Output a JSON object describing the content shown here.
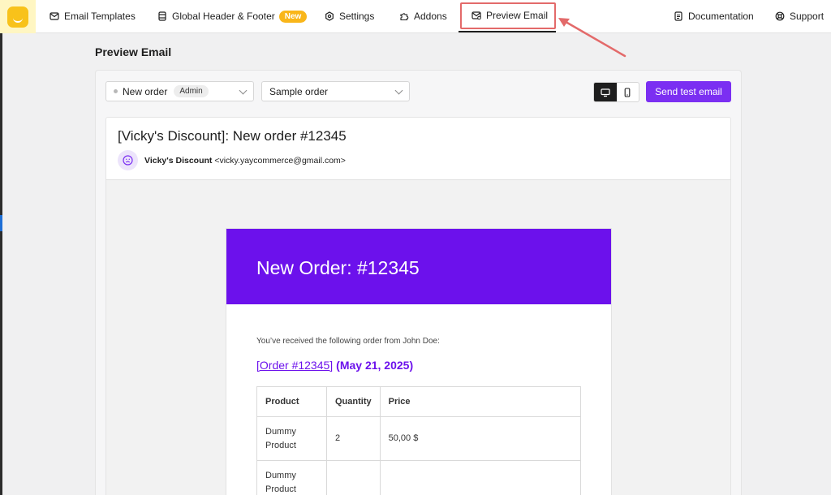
{
  "nav": {
    "items": [
      {
        "label": "Email Templates",
        "icon": "email-templates-icon"
      },
      {
        "label": "Global Header & Footer",
        "icon": "layout-icon",
        "badge": "New"
      },
      {
        "label": "Settings",
        "icon": "gear-icon"
      },
      {
        "label": "Addons",
        "icon": "puzzle-icon"
      },
      {
        "label": "Preview Email",
        "icon": "envelope-preview-icon",
        "active": true
      }
    ],
    "right": [
      {
        "label": "Documentation",
        "icon": "document-icon"
      },
      {
        "label": "Support",
        "icon": "lifebuoy-icon"
      }
    ]
  },
  "page": {
    "title": "Preview Email"
  },
  "toolbar": {
    "template_select": {
      "value": "New order",
      "tag": "Admin"
    },
    "order_select": {
      "value": "Sample order"
    },
    "view_modes": [
      "desktop",
      "mobile"
    ],
    "active_view": "desktop",
    "send_label": "Send test email"
  },
  "email": {
    "subject": "[Vicky's Discount]: New order #12345",
    "sender_name": "Vicky's Discount",
    "sender_email": "<vicky.yaycommerce@gmail.com>",
    "banner_title": "New Order: #12345",
    "intro": "You’ve received the following order from John Doe:",
    "order_link": "[Order #12345]",
    "order_date": "(May 21, 2025)",
    "table": {
      "headers": [
        "Product",
        "Quantity",
        "Price"
      ],
      "rows": [
        [
          "Dummy Product",
          "2",
          "50,00 $"
        ],
        [
          "Dummy Product",
          "",
          ""
        ]
      ]
    }
  },
  "colors": {
    "accent": "#7b2ff2",
    "banner": "#6c11ec",
    "badge": "#f9b61a",
    "annotation": "#e36a6a"
  }
}
